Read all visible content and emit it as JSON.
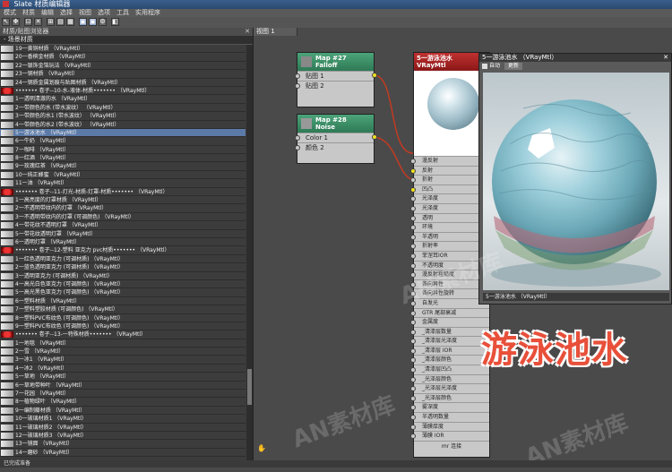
{
  "title": "Slate 材质编辑器",
  "menu": [
    "模式",
    "材质",
    "编辑",
    "选择",
    "视图",
    "选项",
    "工具",
    "实用程序"
  ],
  "left_panel": {
    "title": "材质/贴图浏览器",
    "section": "- 场景材质",
    "rows": [
      {
        "label": "19一黄铜材质 （VRayMtl）",
        "selected": false,
        "group": false
      },
      {
        "label": "20一香槟金材质 （VRayMtl）",
        "selected": false,
        "group": false
      },
      {
        "label": "22一银饰金箔玩法 （VRayMtl）",
        "selected": false,
        "group": false
      },
      {
        "label": "23一钢材质 （VRayMtl）",
        "selected": false,
        "group": false
      },
      {
        "label": "24一钢质金属划痕与贴图材质 （VRayMtl）",
        "selected": false,
        "group": false
      },
      {
        "label": "••••••• 卷子--10-水-液体-材质••••••• （VRayMtl）",
        "selected": false,
        "group": true
      },
      {
        "label": "1一透明清澈的水 （VRayMtl）",
        "selected": false,
        "group": false
      },
      {
        "label": "2一带颜色的水 (带水波纹） （VRayMtl）",
        "selected": false,
        "group": false
      },
      {
        "label": "3一带颜色的水1 (带水波纹） （VRayMtl）",
        "selected": false,
        "group": false
      },
      {
        "label": "4一带颜色的水2 (带水波纹） （VRayMtl）",
        "selected": false,
        "group": false
      },
      {
        "label": "5一游泳池水 （VRayMtl）",
        "selected": true,
        "group": false
      },
      {
        "label": "6一牛奶 （VRayMtl）",
        "selected": false,
        "group": false
      },
      {
        "label": "7一咖啡 （VRayMtl）",
        "selected": false,
        "group": false
      },
      {
        "label": "8一红酒 （VRayMtl）",
        "selected": false,
        "group": false
      },
      {
        "label": "9一玫瑰红茶 （VRayMtl）",
        "selected": false,
        "group": false
      },
      {
        "label": "10一纯正蜂蜜 （VRayMtl）",
        "selected": false,
        "group": false
      },
      {
        "label": "11一油 （VRayMtl）",
        "selected": false,
        "group": false
      },
      {
        "label": "••••••• 卷子--11-灯光-材质-灯罩-材质••••••• （VRayMtl）",
        "selected": false,
        "group": true
      },
      {
        "label": "1一高亮度的灯罩材质 （VRayMtl）",
        "selected": false,
        "group": false
      },
      {
        "label": "2一不透明带纹内的灯罩 （VRayMtl）",
        "selected": false,
        "group": false
      },
      {
        "label": "3一不透明带纹内的灯罩 (可调颜色) （VRayMtl）",
        "selected": false,
        "group": false
      },
      {
        "label": "4一带花纹不透明灯罩 （VRayMtl）",
        "selected": false,
        "group": false
      },
      {
        "label": "5一带花纹透明灯罩 （VRayMtl）",
        "selected": false,
        "group": false
      },
      {
        "label": "6一透明灯罩 （VRayMtl）",
        "selected": false,
        "group": false
      },
      {
        "label": "••••••• 卷子--12-塑料 亚克力 pvc材质••••••• （VRayMtl）",
        "selected": false,
        "group": true
      },
      {
        "label": "1一红色透明亚克力 (可调材质) （VRayMtl）",
        "selected": false,
        "group": false
      },
      {
        "label": "2一蓝色透明亚克力 (可调材质) （VRayMtl）",
        "selected": false,
        "group": false
      },
      {
        "label": "3一透明亚克力 (可调材质) （VRayMtl）",
        "selected": false,
        "group": false
      },
      {
        "label": "4一高光白色亚克力 (可调颜色) （VRayMtl）",
        "selected": false,
        "group": false
      },
      {
        "label": "5一高光黑色亚克力 (可调颜色) （VRayMtl）",
        "selected": false,
        "group": false
      },
      {
        "label": "6一塑料材质 （VRayMtl）",
        "selected": false,
        "group": false
      },
      {
        "label": "7一塑料塑胶材质 (可调颜色) （VRayMtl）",
        "selected": false,
        "group": false
      },
      {
        "label": "8一塑料PVC布纹色 (可调颜色) （VRayMtl）",
        "selected": false,
        "group": false
      },
      {
        "label": "9一塑料PVC布纹色 (可调颜色) （VRayMtl）",
        "selected": false,
        "group": false
      },
      {
        "label": "••••••• 卷子--13-一特殊材质••••••• （VRayMtl）",
        "selected": false,
        "group": true
      },
      {
        "label": "1一地毯 （VRayMtl）",
        "selected": false,
        "group": false
      },
      {
        "label": "2一雪 （VRayMtl）",
        "selected": false,
        "group": false
      },
      {
        "label": "3一冰1 （VRayMtl）",
        "selected": false,
        "group": false
      },
      {
        "label": "4一冰2 （VRayMtl）",
        "selected": false,
        "group": false
      },
      {
        "label": "5一草地 （VRayMtl）",
        "selected": false,
        "group": false
      },
      {
        "label": "6一草地带种叶 （VRayMtl）",
        "selected": false,
        "group": false
      },
      {
        "label": "7一花园 （VRayMtl）",
        "selected": false,
        "group": false
      },
      {
        "label": "8一植物绿叶 （VRayMtl）",
        "selected": false,
        "group": false
      },
      {
        "label": "9一编制藤材质 （VRayMtl）",
        "selected": false,
        "group": false
      },
      {
        "label": "10一玻璃材质1 （VRayMtl）",
        "selected": false,
        "group": false
      },
      {
        "label": "11一玻璃材质2 （VRayMtl）",
        "selected": false,
        "group": false
      },
      {
        "label": "12一玻璃材质3 （VRayMtl）",
        "selected": false,
        "group": false
      },
      {
        "label": "13一镜面 （VRayMtl）",
        "selected": false,
        "group": false
      },
      {
        "label": "14一磨砂 （VRayMtl）",
        "selected": false,
        "group": false
      }
    ]
  },
  "canvas": {
    "tab": "视图 1",
    "node_falloff": {
      "title": "Map #27",
      "subtitle": "Falloff",
      "ports": [
        "贴图 1",
        "贴图 2"
      ]
    },
    "node_noise": {
      "title": "Map #28",
      "subtitle": "Noise",
      "ports": [
        "Color 1",
        "颜色 2"
      ]
    },
    "material": {
      "title": "5一游泳池水",
      "subtitle": "VRayMtl",
      "ports": [
        "漫反射",
        "反射",
        "折射",
        "凹凸",
        "光泽度",
        "光泽度",
        "透明",
        "环境",
        "半透明",
        "折射率",
        "菲涅耳IOR",
        "不透明度",
        "漫反射粗糙度",
        "各向异性",
        "各向异性旋转",
        "自发光",
        "GTR 尾部衰减",
        "金属度",
        "_清漆层数量",
        "_清漆层光泽度",
        "_清漆层 IOR",
        "_清漆层颜色",
        "_清漆层凹凸",
        "_光泽层颜色",
        "_光泽层光泽度",
        "_光泽层颜色",
        "雾深度",
        "半透明数量",
        "薄膜厚度",
        "薄膜 IOR"
      ],
      "footer": "mr 连接"
    }
  },
  "preview": {
    "title": "5一游泳池水 （VRayMtl）",
    "auto_label": "自动",
    "update_label": "更新",
    "footer": "5一游泳池水 （VRayMtl）"
  },
  "big_title": "游泳池水",
  "watermark": "AN素材库",
  "status": "已完成准备"
}
